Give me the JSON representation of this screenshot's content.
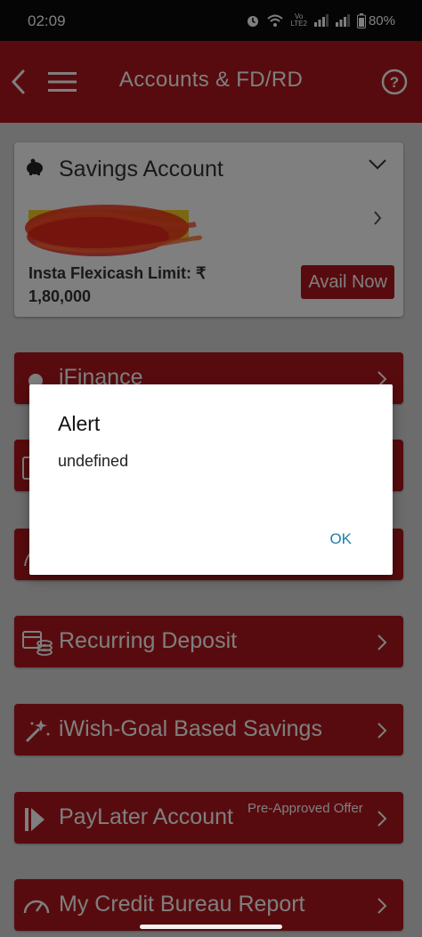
{
  "status_bar": {
    "time": "02:09",
    "volte_top": "Vo",
    "volte_bottom": "LTE2",
    "battery": "80%"
  },
  "header": {
    "title": "Accounts & FD/RD",
    "help_symbol": "?"
  },
  "savings_card": {
    "title": "Savings Account",
    "flexicash_label": "Insta Flexicash Limit: ₹ 1,80,000",
    "avail_button": "Avail Now"
  },
  "menu": {
    "items": [
      {
        "label": "iFinance",
        "icon": "ifinance-icon"
      },
      {
        "label": "",
        "icon": "deposit-icon"
      },
      {
        "label": "",
        "icon": "leaf-icon"
      },
      {
        "label": "Recurring Deposit",
        "icon": "recurring-deposit-icon"
      },
      {
        "label": "iWish-Goal Based Savings",
        "icon": "magic-wand-icon"
      },
      {
        "label": "PayLater Account",
        "sub": "Pre-Approved Offer",
        "icon": "play-skip-icon"
      },
      {
        "label": "My Credit Bureau Report",
        "icon": "speedometer-icon"
      }
    ]
  },
  "dialog": {
    "title": "Alert",
    "message": "undefined",
    "ok_label": "OK"
  },
  "colors": {
    "brand": "#b0161c",
    "link": "#1f7fa8"
  }
}
